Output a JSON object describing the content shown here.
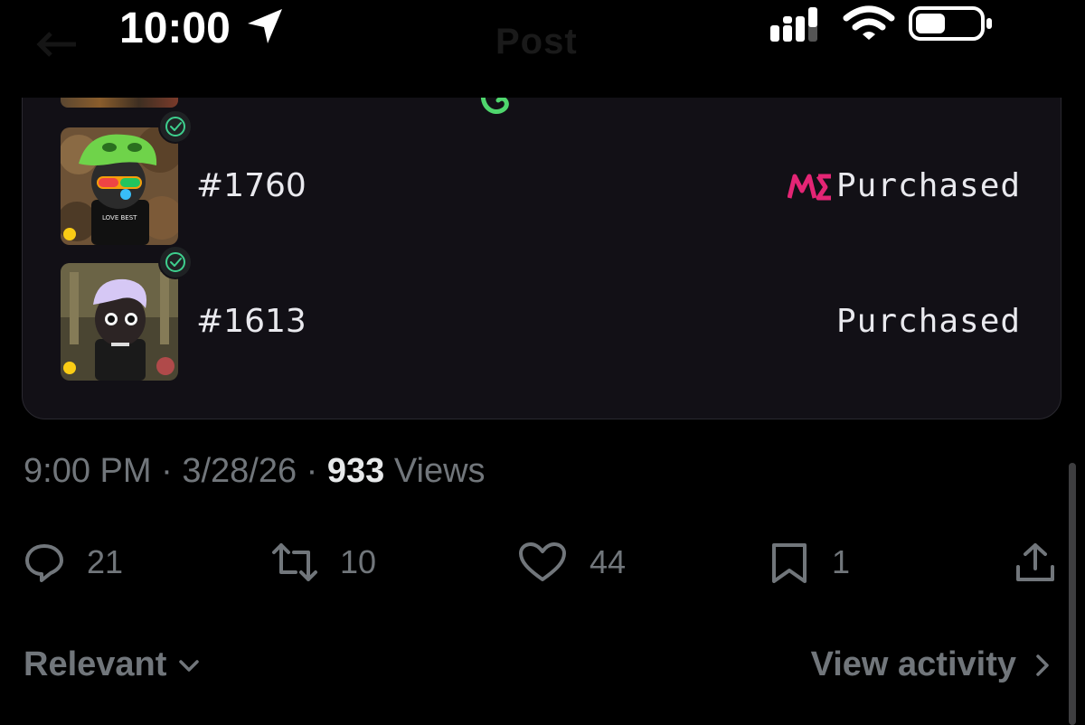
{
  "status_bar": {
    "time": "10:00",
    "icons": [
      "location-arrow-icon",
      "cellular-signal-icon",
      "wifi-icon",
      "battery-icon"
    ]
  },
  "header": {
    "title": "Post"
  },
  "card": {
    "items": [
      {
        "token": "#1760",
        "status": "Purchased",
        "marketplace_icon": "magic-eden-logo",
        "verified": true
      },
      {
        "token": "#1613",
        "status": "Purchased",
        "verified": true
      }
    ]
  },
  "meta": {
    "time": "9:00 PM",
    "sep1": " · ",
    "date": "3/28/26",
    "sep2": " · ",
    "views_count": "933",
    "views_label": " Views"
  },
  "actions": {
    "replies": "21",
    "reposts": "10",
    "likes": "44",
    "bookmarks": "1"
  },
  "footer": {
    "sort_label": "Relevant",
    "activity_label": "View activity"
  },
  "colors": {
    "background": "#000000",
    "card_bg": "#121016",
    "muted_text": "#71767b",
    "magic_eden_pink": "#e42575",
    "verified_green": "#3ecf8e"
  }
}
